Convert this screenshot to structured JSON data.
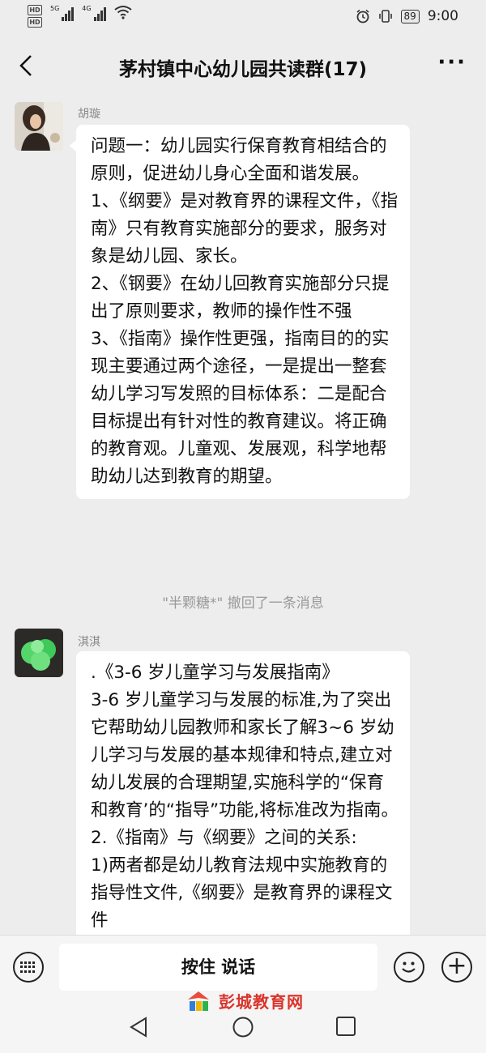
{
  "status_bar": {
    "signal1": "5G",
    "signal2": "4G",
    "battery": "89",
    "time": "9:00"
  },
  "header": {
    "title": "茅村镇中心幼儿园共读群(17)",
    "more": "···"
  },
  "messages": [
    {
      "sender": "胡璇",
      "paragraphs": [
        "问题一：幼儿园实行保育教育相结合的原则，促进幼儿身心全面和谐发展。",
        "1、《纲要》是对教育界的课程文件，《指南》只有教育实施部分的要求，服务对象是幼儿园、家长。",
        "2、《钢要》在幼儿回教育实施部分只提出了原则要求，教师的操作性不强",
        "3、《指南》操作性更强，指南目的的实现主要通过两个途径，一是提出一整套幼儿学习写发照的目标体系：二是配合目标提出有针对性的教育建议。将正确的教育观。儿童观、发展观，科学地帮助幼儿达到教育的期望。"
      ]
    },
    {
      "sender": "淇淇",
      "paragraphs": [
        ".《3-6 岁儿童学习与发展指南》",
        "3-6 岁儿童学习与发展的标准,为了突出它帮助幼儿园教师和家长了解3~6 岁幼儿学习与发展的基本规律和特点,建立对幼儿发展的合理期望,实施科学的“保育和教育’的“指导”功能,将标准改为指南。",
        "2.《指南》与《纲要》之间的关系:",
        "1)两者都是幼儿教育法规中实施教育的指导性文件,《纲要》是教育界的课程文件"
      ]
    }
  ],
  "system_message": "\"半颗糖*\" 撤回了一条消息",
  "input_bar": {
    "hold_to_talk": "按住 说话"
  },
  "watermark": "彭城教育网",
  "colors": {
    "background": "#ededed",
    "bubble": "#ffffff",
    "watermark": "#d9342b"
  }
}
